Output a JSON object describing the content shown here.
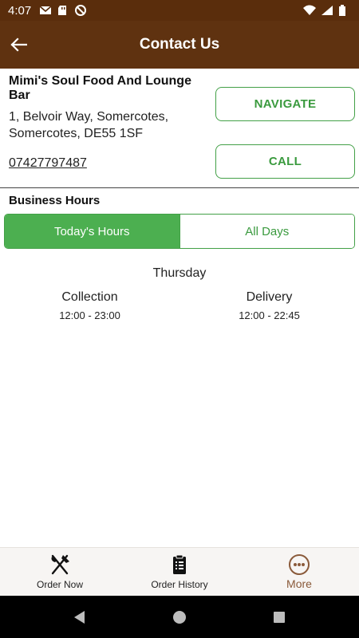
{
  "status_bar": {
    "time": "4:07",
    "left_icons": [
      "gmail-icon",
      "sd-card-icon",
      "no-disturb-icon"
    ],
    "right_icons": [
      "wifi-icon",
      "signal-icon",
      "battery-icon"
    ]
  },
  "app_bar": {
    "title": "Contact Us",
    "back_icon": "arrow-left-icon"
  },
  "business": {
    "name": "Mimi's Soul Food And Lounge Bar",
    "address": "1, Belvoir Way, Somercotes, Somercotes, DE55 1SF",
    "phone": "07427797487"
  },
  "actions": {
    "navigate_label": "NAVIGATE",
    "call_label": "CALL"
  },
  "hours": {
    "title": "Business Hours",
    "tabs": [
      {
        "label": "Today's Hours",
        "active": true
      },
      {
        "label": "All Days",
        "active": false
      }
    ],
    "day": "Thursday",
    "columns": [
      {
        "type": "Collection",
        "range": "12:00 - 23:00"
      },
      {
        "type": "Delivery",
        "range": "12:00 - 22:45"
      }
    ]
  },
  "bottom_nav": {
    "items": [
      {
        "label": "Order Now",
        "icon": "fork-knife-icon",
        "active": false
      },
      {
        "label": "Order History",
        "icon": "clipboard-icon",
        "active": false
      },
      {
        "label": "More",
        "icon": "more-dots-icon",
        "active": true
      }
    ]
  },
  "colors": {
    "app_bar": "#5f3210",
    "status_bar": "#5a2d0c",
    "accent_green": "#4caf50",
    "active_nav": "#8a5a3a"
  }
}
